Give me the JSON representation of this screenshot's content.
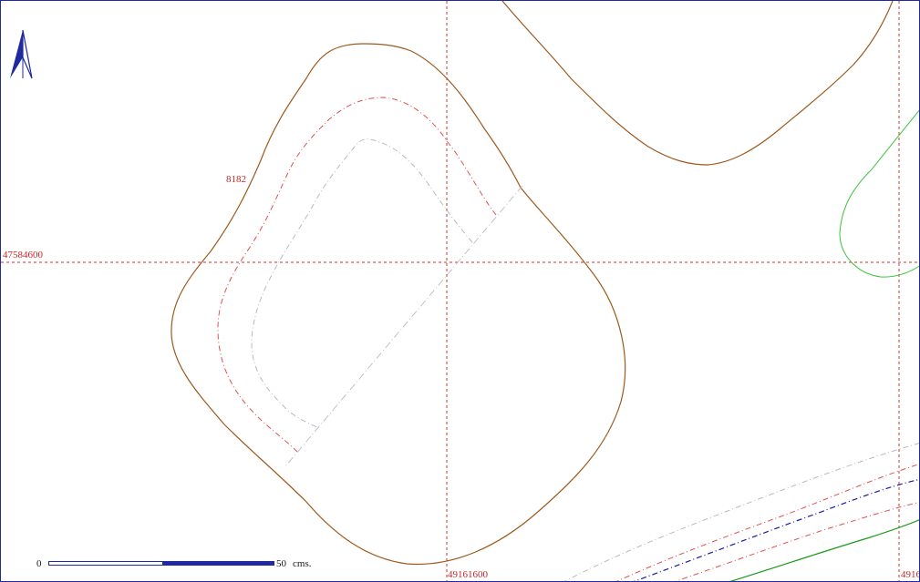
{
  "map": {
    "grid": {
      "y_label": "47584600",
      "x_label_center": "49161600",
      "x_label_right": "4916"
    },
    "contour_label": "8182",
    "scale": {
      "start": "0",
      "end": "50",
      "unit": "cms."
    },
    "north_arrow": "north-arrow-icon",
    "colors": {
      "frame": "#1f2a9e",
      "grid": "#d32f2f",
      "contour_brown": "#9c5a1f",
      "contour_red": "#e05050",
      "contour_grey": "#b8b8c8",
      "contour_green": "#3cc33c",
      "contour_darkgreen": "#1a9a1a",
      "contour_blue": "#1a1aa0"
    }
  }
}
